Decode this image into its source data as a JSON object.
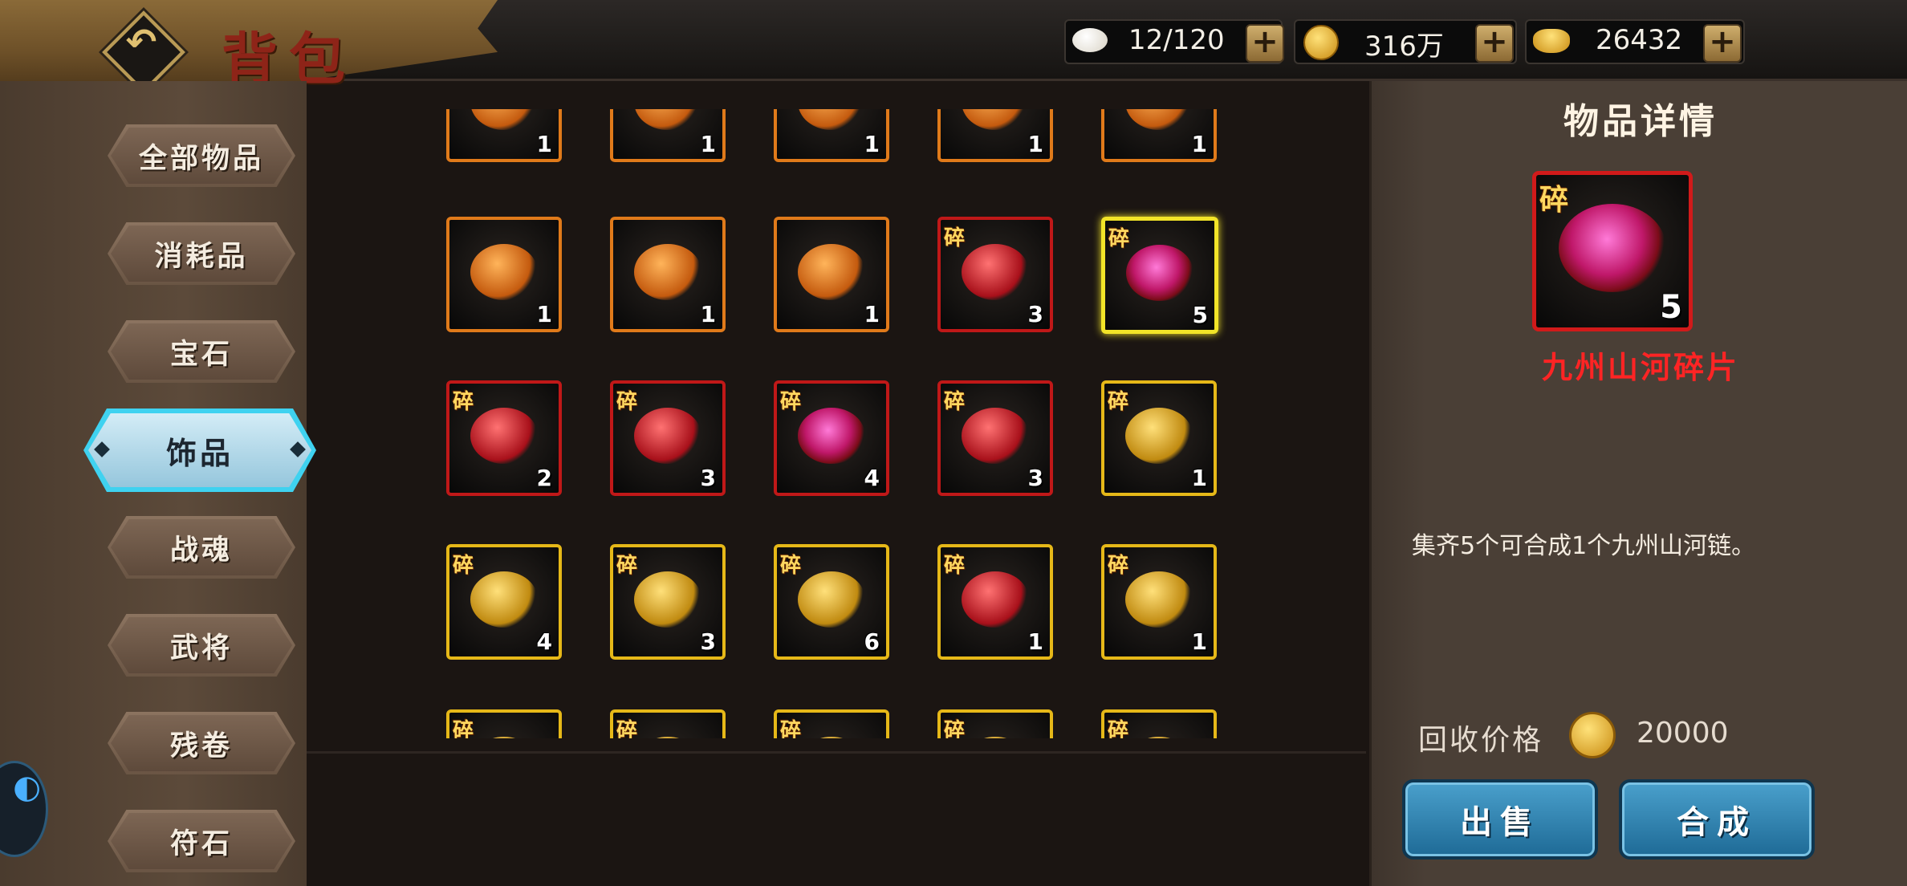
{
  "header": {
    "title": "背包",
    "back_icon": "back-arrow-icon",
    "resources": [
      {
        "name": "bun",
        "icon": "steamed-bun-icon",
        "value": "12/120"
      },
      {
        "name": "copper",
        "icon": "gold-coin-icon",
        "value": "316万"
      },
      {
        "name": "ingot",
        "icon": "gold-ingot-icon",
        "value": "26432"
      }
    ],
    "plus_label": "+"
  },
  "sidebar": {
    "items": [
      {
        "label": "全部物品",
        "active": false
      },
      {
        "label": "消耗品",
        "active": false
      },
      {
        "label": "宝石",
        "active": false
      },
      {
        "label": "饰品",
        "active": true
      },
      {
        "label": "战魂",
        "active": false
      },
      {
        "label": "武将",
        "active": false
      },
      {
        "label": "残卷",
        "active": false
      },
      {
        "label": "符石",
        "active": false
      }
    ]
  },
  "grid": {
    "fragment_badge": "碎",
    "rows": [
      [
        {
          "rarity": "orange",
          "fragment": false,
          "count": "1",
          "art": "o"
        },
        {
          "rarity": "orange",
          "fragment": false,
          "count": "1",
          "art": "o"
        },
        {
          "rarity": "orange",
          "fragment": false,
          "count": "1",
          "art": "o"
        },
        {
          "rarity": "orange",
          "fragment": false,
          "count": "1",
          "art": "o"
        },
        {
          "rarity": "orange",
          "fragment": false,
          "count": "1",
          "art": "o"
        }
      ],
      [
        {
          "rarity": "orange",
          "fragment": false,
          "count": "1",
          "art": "o"
        },
        {
          "rarity": "orange",
          "fragment": false,
          "count": "1",
          "art": "o"
        },
        {
          "rarity": "orange",
          "fragment": false,
          "count": "1",
          "art": "o"
        },
        {
          "rarity": "red",
          "fragment": true,
          "count": "3",
          "art": "r"
        },
        {
          "rarity": "sel",
          "fragment": true,
          "count": "5",
          "art": "p"
        }
      ],
      [
        {
          "rarity": "red",
          "fragment": true,
          "count": "2",
          "art": "r"
        },
        {
          "rarity": "red",
          "fragment": true,
          "count": "3",
          "art": "r"
        },
        {
          "rarity": "red",
          "fragment": true,
          "count": "4",
          "art": "p"
        },
        {
          "rarity": "red",
          "fragment": true,
          "count": "3",
          "art": "r"
        },
        {
          "rarity": "gold",
          "fragment": true,
          "count": "1",
          "art": "g"
        }
      ],
      [
        {
          "rarity": "gold",
          "fragment": true,
          "count": "4",
          "art": "g"
        },
        {
          "rarity": "gold",
          "fragment": true,
          "count": "3",
          "art": "g"
        },
        {
          "rarity": "gold",
          "fragment": true,
          "count": "6",
          "art": "g"
        },
        {
          "rarity": "gold",
          "fragment": true,
          "count": "1",
          "art": "r"
        },
        {
          "rarity": "gold",
          "fragment": true,
          "count": "1",
          "art": "g"
        }
      ],
      [
        {
          "rarity": "gold",
          "fragment": true,
          "count": "",
          "art": "g"
        },
        {
          "rarity": "gold",
          "fragment": true,
          "count": "",
          "art": "g"
        },
        {
          "rarity": "gold",
          "fragment": true,
          "count": "",
          "art": "g"
        },
        {
          "rarity": "gold",
          "fragment": true,
          "count": "",
          "art": "g"
        },
        {
          "rarity": "gold",
          "fragment": true,
          "count": "",
          "art": "g"
        }
      ]
    ]
  },
  "detail": {
    "title": "物品详情",
    "item": {
      "name": "九州山河碎片",
      "count": "5",
      "fragment_badge": "碎"
    },
    "description": "集齐5个可合成1个九州山河链。",
    "recycle_label": "回收价格",
    "recycle_icon": "gold-coin-icon",
    "recycle_price": "20000",
    "sell_label": "出售",
    "compose_label": "合成"
  },
  "colors": {
    "orange": "#e07a1a",
    "red": "#c01818",
    "gold": "#e6b818",
    "selected": "#f2e428",
    "item_name": "#ff2424",
    "active_tab": "#3fd2f0"
  }
}
